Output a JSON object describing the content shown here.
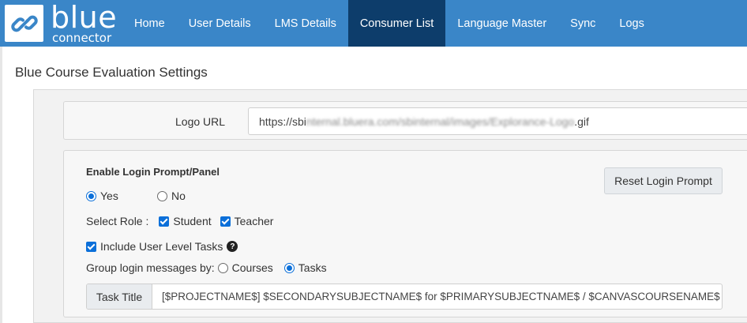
{
  "brand": {
    "name": "blue",
    "sub": "connector"
  },
  "nav": [
    {
      "label": "Home",
      "active": false
    },
    {
      "label": "User Details",
      "active": false
    },
    {
      "label": "LMS Details",
      "active": false
    },
    {
      "label": "Consumer List",
      "active": true
    },
    {
      "label": "Language Master",
      "active": false
    },
    {
      "label": "Sync",
      "active": false
    },
    {
      "label": "Logs",
      "active": false
    }
  ],
  "page": {
    "title": "Blue Course Evaluation Settings"
  },
  "logo_url": {
    "label": "Logo URL",
    "value_prefix": "https://sbi",
    "value_blurred": "nternal.bluera.com/sbinternal/images/Explorance-Logo",
    "value_suffix": ".gif"
  },
  "login": {
    "heading": "Enable Login Prompt/Panel",
    "yes_label": "Yes",
    "no_label": "No",
    "enabled": "Yes",
    "select_role_label": "Select Role :",
    "roles": [
      {
        "label": "Student",
        "checked": true
      },
      {
        "label": "Teacher",
        "checked": true
      }
    ],
    "include_user_tasks_label": "Include User Level Tasks",
    "include_user_tasks_checked": true,
    "group_by_label": "Group login messages by:",
    "group_by_options": [
      "Courses",
      "Tasks"
    ],
    "group_by_selected": "Tasks",
    "reset_button": "Reset Login Prompt",
    "task_title_label": "Task Title",
    "task_title_value": "[$PROJECTNAME$] $SECONDARYSUBJECTNAME$ for $PRIMARYSUBJECTNAME$ / $CANVASCOURSENAME$"
  },
  "colors": {
    "nav_bg": "#3a86c8",
    "nav_active": "#0d3d6b",
    "accent": "#0b6fd9"
  }
}
